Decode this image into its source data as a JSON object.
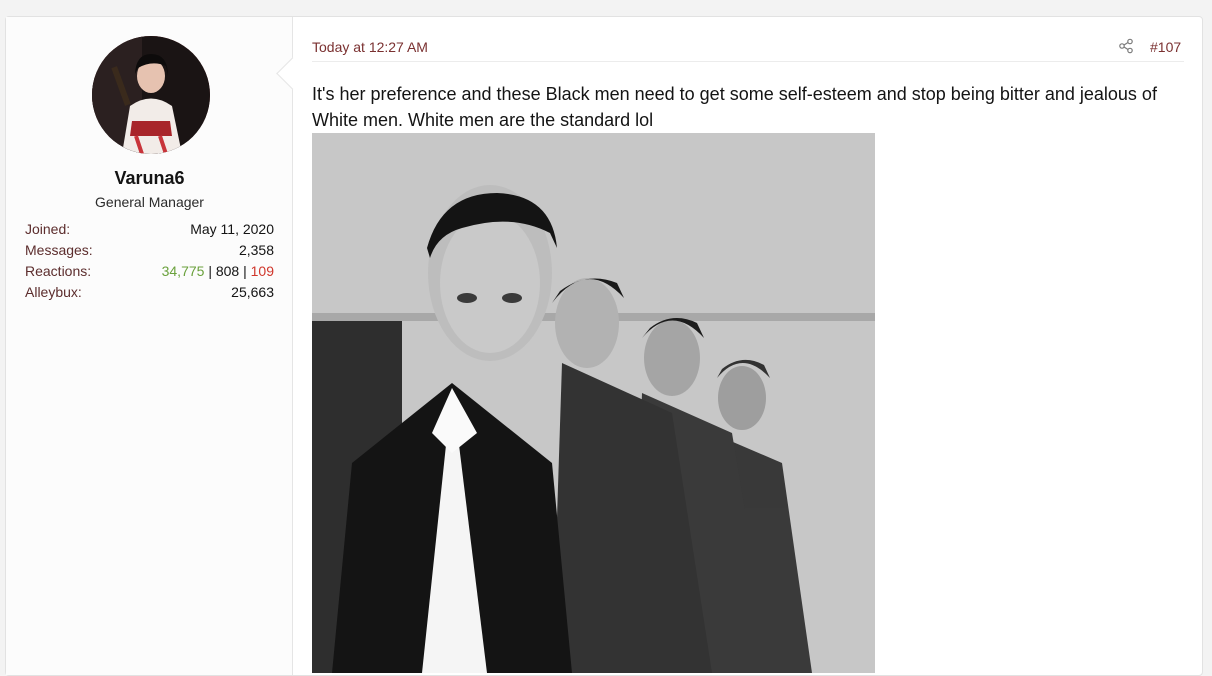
{
  "user": {
    "name": "Varuna6",
    "title": "General Manager",
    "stats": [
      {
        "label": "Joined:",
        "value": "May 11, 2020"
      },
      {
        "label": "Messages:",
        "value": "2,358"
      },
      {
        "label": "Alleybux:",
        "value": "25,663"
      }
    ],
    "reactions": {
      "label": "Reactions:",
      "positive": "34,775",
      "neutral": "808",
      "negative": "109",
      "separator": "|"
    }
  },
  "post": {
    "time": "Today at 12:27 AM",
    "number": "#107",
    "text": "It's her preference and these Black men need to get some self-esteem and stop being bitter and jealous of White men. White men are the standard lol",
    "share_icon": "share-icon"
  },
  "colors": {
    "positive": "#6aa13c",
    "negative": "#d0362b",
    "link": "#7a3030"
  }
}
